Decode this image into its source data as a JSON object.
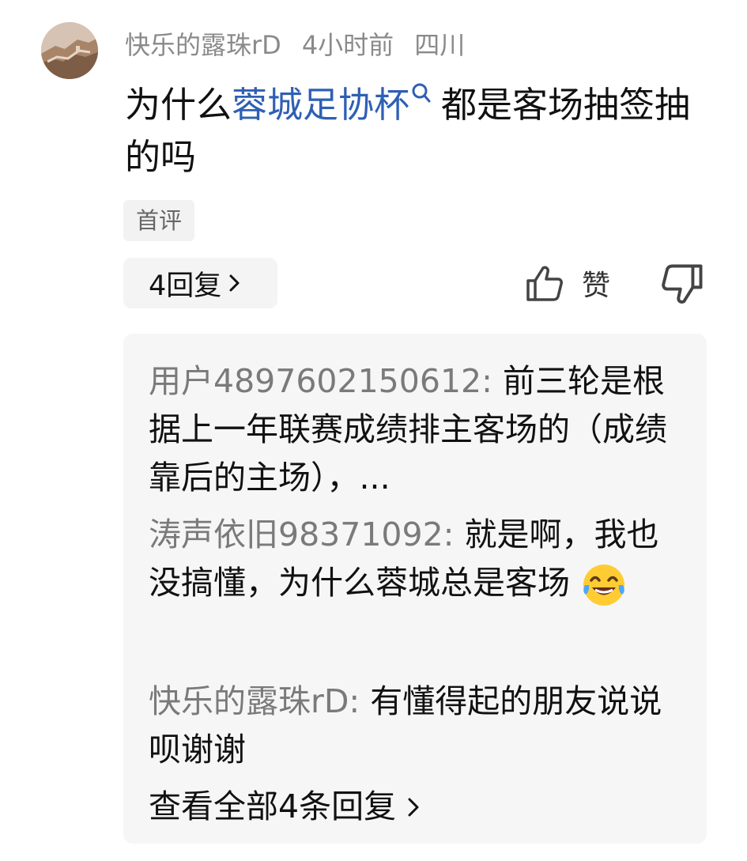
{
  "comment": {
    "username": "快乐的露珠rD",
    "time": "4小时前",
    "location": "四川",
    "text_before": "为什么",
    "keyword": "蓉城足协杯",
    "text_after": "都是客场抽签抽的吗",
    "tag": "首评",
    "reply_count_label": "4回复",
    "like_label": "赞"
  },
  "replies": [
    {
      "author": "用户4897602150612:",
      "text": "前三轮是根据上一年联赛成绩排主客场的（成绩靠后的主场），..."
    },
    {
      "author": "涛声依旧98371092:",
      "text": "就是啊，我也没搞懂，为什么蓉城总是客场",
      "emoji": "tears-of-joy-emoji"
    },
    {
      "author": "快乐的露珠rD:",
      "text": "有懂得起的朋友说说呗谢谢"
    }
  ],
  "view_all_label": "查看全部4条回复",
  "icons": {
    "keyword_search": "search-icon",
    "reply_chevron": "chevron-right-icon",
    "like": "thumbs-up-icon",
    "dislike": "thumbs-down-icon"
  },
  "colors": {
    "keyword": "#2f5fb4",
    "username": "#8a8a8a",
    "reply_background": "#f6f6f7"
  }
}
